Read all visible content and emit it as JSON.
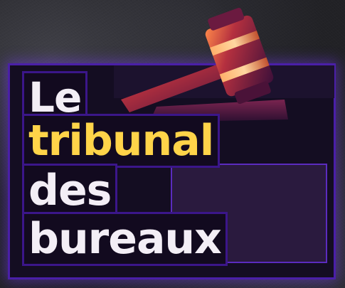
{
  "title": {
    "line1": "Le",
    "line2": "tribunal",
    "line3": "des",
    "line4": "bureaux"
  },
  "colors": {
    "background": "#222226",
    "block": "#140d22",
    "glow": "#6a2cff",
    "text_white": "#f3eef6",
    "text_yellow": "#ffd449",
    "gavel_wood": "#5a1a3a",
    "gavel_highlight": "#ff7a3a"
  },
  "icons": {
    "gavel": "gavel-icon"
  }
}
